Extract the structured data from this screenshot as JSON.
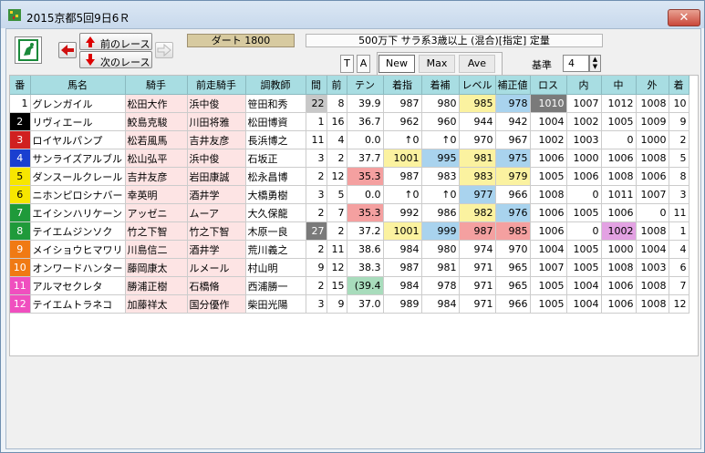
{
  "window": {
    "title": "2015京都5回9日6Ｒ",
    "close_label": "✕"
  },
  "toolbar": {
    "prev_label": "前のレース",
    "next_label": "次のレース",
    "track": "ダート 1800",
    "race_info": "500万下  サラ系3歳以上 (混合)[指定]  定量",
    "tab_t": "T",
    "tab_a": "A",
    "mode_new": "New",
    "mode_max": "Max",
    "mode_ave": "Ave",
    "kijun_label": "基準",
    "kijun_value": "4"
  },
  "colors": {
    "header_bg": "#a8dde2",
    "yellow": "#fbf2a0",
    "blue": "#a9d3ee",
    "red": "#f4a0a0",
    "pink": "#fde4e4",
    "green": "#a8dcbc",
    "gray": "#c8c8c8",
    "darkgray": "#7a7a7a",
    "purple": "#e3a2e3"
  },
  "columns": [
    "番",
    "馬名",
    "騎手",
    "前走騎手",
    "調教師",
    "間",
    "前",
    "テン",
    "着指",
    "着補",
    "レベル",
    "補正値",
    "ロス",
    "内",
    "中",
    "外",
    "着"
  ],
  "rows": [
    {
      "waku_color": "#ffffff",
      "waku_text": "#000000",
      "cells": [
        "1",
        "グレンガイル",
        "松田大作",
        "浜中俊",
        "笹田和秀",
        "22",
        "8",
        "39.9",
        "987",
        "980",
        "985",
        "978",
        "1010",
        "1007",
        "1012",
        "1008",
        "10"
      ],
      "hl": {
        "5": "gray",
        "10": "yellow",
        "11": "blue",
        "12": "darkgray"
      }
    },
    {
      "waku_color": "#000000",
      "waku_text": "#ffffff",
      "cells": [
        "2",
        "リヴィエール",
        "鮫島克駿",
        "川田将雅",
        "松田博資",
        "1",
        "16",
        "36.7",
        "962",
        "960",
        "944",
        "942",
        "1004",
        "1002",
        "1005",
        "1009",
        "9"
      ],
      "hl": {}
    },
    {
      "waku_color": "#d02020",
      "waku_text": "#ffffff",
      "cells": [
        "3",
        "ロイヤルパンプ",
        "松若風馬",
        "吉井友彦",
        "長浜博之",
        "11",
        "4",
        "0.0",
        "↑0",
        "↑0",
        "970",
        "967",
        "1002",
        "1003",
        "0",
        "1000",
        "2"
      ],
      "hl": {}
    },
    {
      "waku_color": "#1a3fd0",
      "waku_text": "#ffffff",
      "cells": [
        "4",
        "サンライズアルブル",
        "松山弘平",
        "浜中俊",
        "石坂正",
        "3",
        "2",
        "37.7",
        "1001",
        "995",
        "981",
        "975",
        "1006",
        "1000",
        "1006",
        "1008",
        "5"
      ],
      "hl": {
        "8": "yellow",
        "9": "blue",
        "10": "yellow",
        "11": "blue"
      }
    },
    {
      "waku_color": "#f7e600",
      "waku_text": "#000000",
      "cells": [
        "5",
        "ダンスールクレール",
        "吉井友彦",
        "岩田康誠",
        "松永昌博",
        "2",
        "12",
        "35.3",
        "987",
        "983",
        "983",
        "979",
        "1005",
        "1006",
        "1008",
        "1006",
        "8"
      ],
      "hl": {
        "7": "red",
        "10": "yellow",
        "11": "yellow"
      }
    },
    {
      "waku_color": "#f7e600",
      "waku_text": "#000000",
      "cells": [
        "6",
        "ニホンピロシナバー",
        "幸英明",
        "酒井学",
        "大橋勇樹",
        "3",
        "5",
        "0.0",
        "↑0",
        "↑0",
        "977",
        "966",
        "1008",
        "0",
        "1011",
        "1007",
        "3"
      ],
      "hl": {
        "10": "blue"
      }
    },
    {
      "waku_color": "#1f9a3a",
      "waku_text": "#ffffff",
      "cells": [
        "7",
        "エイシンハリケーン",
        "アッゼニ",
        "ムーア",
        "大久保龍",
        "2",
        "7",
        "35.3",
        "992",
        "986",
        "982",
        "976",
        "1006",
        "1005",
        "1006",
        "0",
        "11"
      ],
      "hl": {
        "7": "red",
        "10": "yellow",
        "11": "blue"
      }
    },
    {
      "waku_color": "#1f9a3a",
      "waku_text": "#ffffff",
      "cells": [
        "8",
        "テイエムジンソク",
        "竹之下智",
        "竹之下智",
        "木原一良",
        "27",
        "2",
        "37.2",
        "1001",
        "999",
        "987",
        "985",
        "1006",
        "0",
        "1002",
        "1008",
        "1"
      ],
      "hl": {
        "5": "darkgray",
        "8": "yellow",
        "9": "blue",
        "10": "red",
        "11": "red",
        "14": "purple"
      }
    },
    {
      "waku_color": "#f07a14",
      "waku_text": "#ffffff",
      "cells": [
        "9",
        "メイショウヒマワリ",
        "川島信二",
        "酒井学",
        "荒川義之",
        "2",
        "11",
        "38.6",
        "984",
        "980",
        "974",
        "970",
        "1004",
        "1005",
        "1000",
        "1004",
        "4"
      ],
      "hl": {}
    },
    {
      "waku_color": "#f07a14",
      "waku_text": "#ffffff",
      "cells": [
        "10",
        "オンワードハンター",
        "藤岡康太",
        "ルメール",
        "村山明",
        "9",
        "12",
        "38.3",
        "987",
        "981",
        "971",
        "965",
        "1007",
        "1005",
        "1008",
        "1003",
        "6"
      ],
      "hl": {}
    },
    {
      "waku_color": "#f04fbf",
      "waku_text": "#ffffff",
      "cells": [
        "11",
        "アルマセクレタ",
        "勝浦正樹",
        "石橋脩",
        "西浦勝一",
        "2",
        "15",
        "(39.4",
        "984",
        "978",
        "971",
        "965",
        "1005",
        "1004",
        "1006",
        "1008",
        "7"
      ],
      "hl": {
        "7": "green"
      }
    },
    {
      "waku_color": "#f04fbf",
      "waku_text": "#ffffff",
      "cells": [
        "12",
        "テイエムトラネコ",
        "加藤祥太",
        "国分優作",
        "柴田光陽",
        "3",
        "9",
        "37.0",
        "989",
        "984",
        "971",
        "966",
        "1005",
        "1004",
        "1006",
        "1008",
        "12"
      ],
      "hl": {}
    }
  ]
}
